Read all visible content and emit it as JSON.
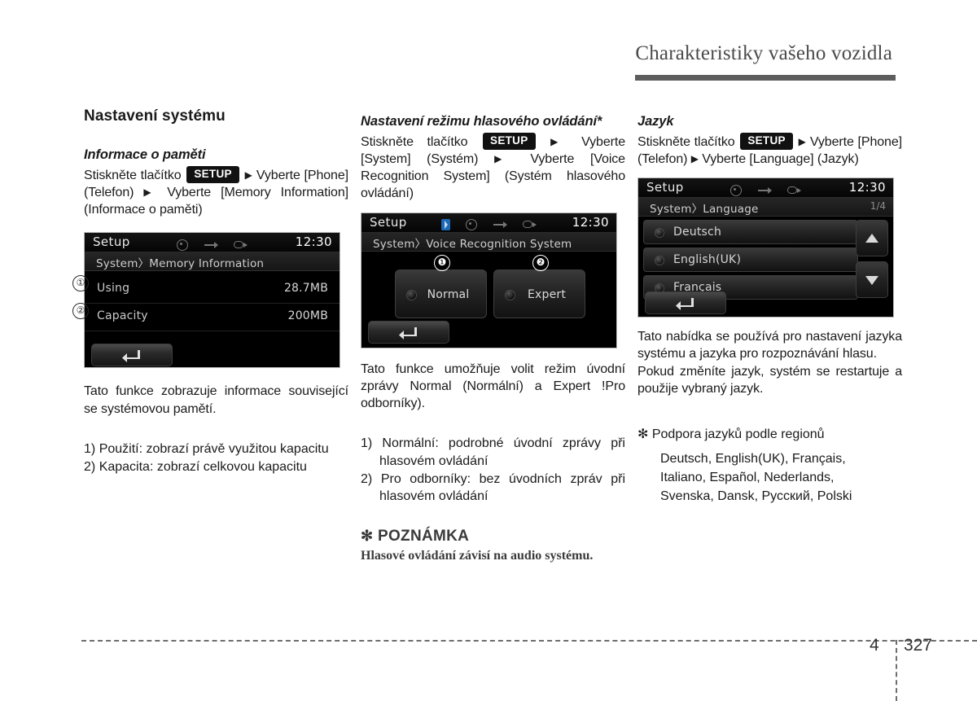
{
  "header": {
    "title": "Charakteristiky vašeho vozidla"
  },
  "footer": {
    "chapter": "4",
    "page": "327"
  },
  "column1": {
    "section_title": "Nastavení systému",
    "sub_title": "Informace o paměti",
    "path_pre": "Stiskněte tlačítko",
    "setup_chip": "SETUP",
    "path_mid": "Vyberte [Phone] (Telefon)",
    "path_end": "Vyberte [Memory Information] (Informace o paměti)",
    "description": "Tato funkce zobrazuje informace související se systémovou pamětí.",
    "list": [
      {
        "num": "1)",
        "text": "Použití: zobrazí právě využitou kapacitu"
      },
      {
        "num": "2)",
        "text": "Kapacita: zobrazí celkovou kapacitu"
      }
    ],
    "callouts": {
      "one": "①",
      "two": "②"
    },
    "device": {
      "title": "Setup",
      "clock": "12:30",
      "breadcrumb": "System〉Memory Information",
      "icons": [
        "disc-icon",
        "usb-icon",
        "aux-icon"
      ],
      "rows": [
        {
          "label": "Using",
          "value": "28.7MB"
        },
        {
          "label": "Capacity",
          "value": "200MB"
        }
      ],
      "back_icon": "back-arrow-icon"
    }
  },
  "column2": {
    "sub_title": "Nastavení režimu hlasového ovládání*",
    "path_pre": "Stiskněte tlačítko",
    "setup_chip": "SETUP",
    "path_mid": "Vyberte [System] (Systém)",
    "path_end": "Vyberte [Voice Recognition System] (Systém hlasového ovládání)",
    "description": "Tato funkce umožňuje volit režim úvodní zprávy Normal (Normální) a Expert !Pro odborníky).",
    "list": [
      {
        "num": "1)",
        "text": "Normální: podrobné úvodní zprávy při hlasovém ovládání"
      },
      {
        "num": "2)",
        "text": "Pro odborníky: bez úvodních zpráv při hlasovém ovládání"
      }
    ],
    "note": {
      "star": "✻",
      "title": "POZNÁMKA",
      "body": "Hlasové ovládání závisí na audio systému."
    },
    "device": {
      "title": "Setup",
      "clock": "12:30",
      "breadcrumb": "System〉Voice Recognition System",
      "icons": [
        "bluetooth-icon",
        "disc-icon",
        "usb-icon",
        "aux-icon"
      ],
      "buttons": [
        {
          "label": "Normal",
          "callout": "❶"
        },
        {
          "label": "Expert",
          "callout": "❷"
        }
      ],
      "back_icon": "back-arrow-icon"
    }
  },
  "column3": {
    "sub_title": "Jazyk",
    "path_pre": "Stiskněte tlačítko",
    "setup_chip": "SETUP",
    "path_mid": "Vyberte [Phone] (Telefon)",
    "path_end": "Vyberte [Language] (Jazyk)",
    "description_1": "Tato nabídka se používá pro nastavení jazyka systému a jazyka pro rozpoznávání hlasu.",
    "description_2": "Pokud změníte jazyk, systém se restartuje a použije vybraný jazyk.",
    "region_star": "✻",
    "region_title": "Podpora jazyků podle regionů",
    "region_lines": [
      "Deutsch, English(UK), Français,",
      "Italiano, Español, Nederlands,",
      "Svenska, Dansk, Русский, Polski"
    ],
    "device": {
      "title": "Setup",
      "clock": "12:30",
      "breadcrumb": "System〉Language",
      "page_indicator": "1/4",
      "icons": [
        "disc-icon",
        "usb-icon",
        "aux-icon"
      ],
      "languages": [
        "Deutsch",
        "English(UK)",
        "Français"
      ],
      "scroll_up_icon": "triangle-up-icon",
      "scroll_down_icon": "triangle-down-icon",
      "back_icon": "back-arrow-icon"
    }
  }
}
